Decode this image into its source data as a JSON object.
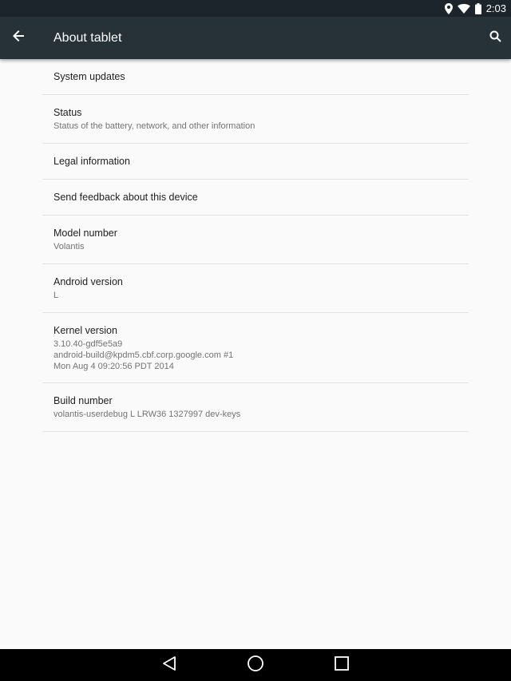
{
  "status_bar": {
    "time": "2:03",
    "icons": [
      "location-icon",
      "wifi-icon",
      "battery-icon"
    ]
  },
  "app_bar": {
    "title": "About tablet",
    "back_icon": "arrow-back-icon",
    "search_icon": "search-icon"
  },
  "items": [
    {
      "title": "System updates",
      "summary": ""
    },
    {
      "title": "Status",
      "summary": "Status of the battery, network, and other information"
    },
    {
      "title": "Legal information",
      "summary": ""
    },
    {
      "title": "Send feedback about this device",
      "summary": ""
    },
    {
      "title": "Model number",
      "summary": "Volantis"
    },
    {
      "title": "Android version",
      "summary": "L"
    },
    {
      "title": "Kernel version",
      "summary": "3.10.40-gdf5e5a9\nandroid-build@kpdm5.cbf.corp.google.com #1\nMon Aug 4 09:20:56 PDT 2014"
    },
    {
      "title": "Build number",
      "summary": "volantis-userdebug L LRW36 1327997 dev-keys"
    }
  ],
  "nav_bar": {
    "icons": [
      "back-triangle-icon",
      "home-circle-icon",
      "recents-square-icon"
    ]
  },
  "colors": {
    "status_bar": "#1c252b",
    "app_bar": "#263238",
    "background": "#fafafa",
    "divider": "#e2e2e2"
  }
}
